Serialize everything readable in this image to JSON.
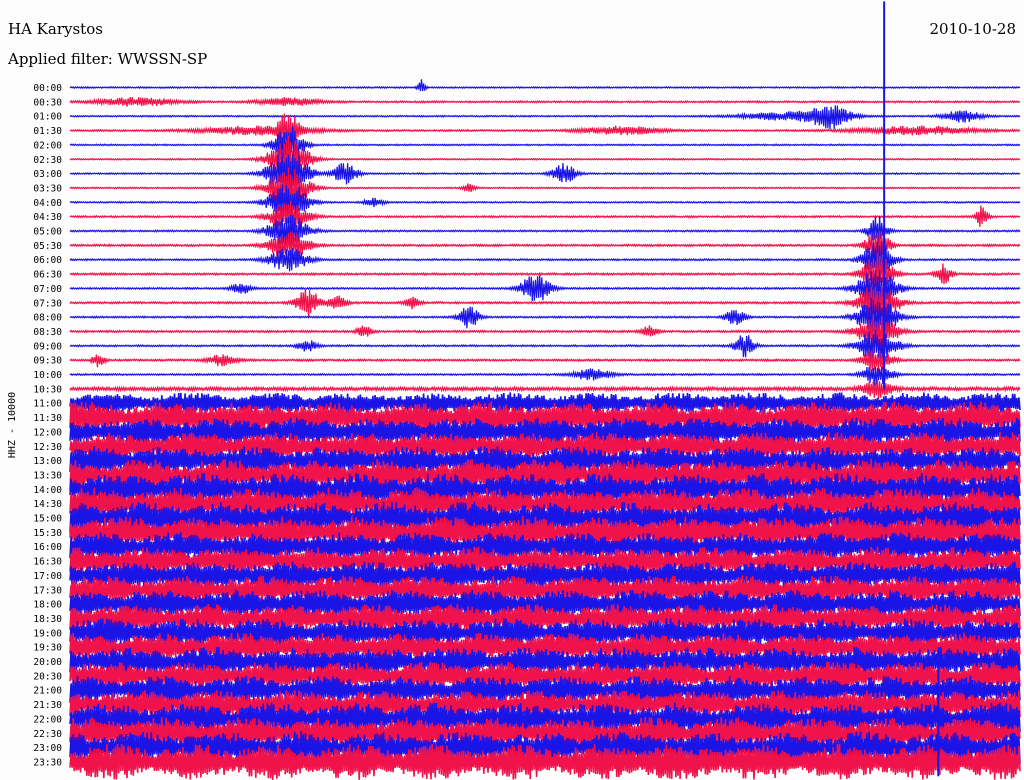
{
  "header": {
    "station": "HA Karystos",
    "date": "2010-10-28",
    "filter_label": "Applied filter: WWSSN-SP"
  },
  "colors": {
    "trace_a": "#1a14e6",
    "trace_b": "#f0124a",
    "background": "#fdfdfd",
    "text": "#000000"
  },
  "chart_data": {
    "type": "line",
    "title": "HA Karystos",
    "subtitle": "Applied filter: WWSSN-SP",
    "ylabel": "HHZ - 10000",
    "xlabel": "",
    "grid": false,
    "legend": "none",
    "row_labels": [
      "00:00",
      "00:30",
      "01:00",
      "01:30",
      "02:00",
      "02:30",
      "03:00",
      "03:30",
      "04:00",
      "04:30",
      "05:00",
      "05:30",
      "06:00",
      "06:30",
      "07:00",
      "07:30",
      "08:00",
      "08:30",
      "09:00",
      "09:30",
      "10:00",
      "10:30",
      "11:00",
      "11:30",
      "12:00",
      "12:30",
      "13:00",
      "13:30",
      "14:00",
      "14:30",
      "15:00",
      "15:30",
      "16:00",
      "16:30",
      "17:00",
      "17:30",
      "18:00",
      "18:30",
      "19:00",
      "19:30",
      "20:00",
      "20:30",
      "21:00",
      "21:30",
      "22:00",
      "22:30",
      "23:00",
      "23:30"
    ],
    "row_noise_amplitude": [
      0.5,
      0.6,
      0.5,
      0.6,
      0.5,
      0.5,
      0.5,
      0.5,
      0.5,
      0.6,
      0.6,
      0.7,
      0.6,
      0.7,
      0.6,
      0.7,
      0.6,
      0.7,
      0.6,
      0.7,
      0.6,
      1.2,
      6,
      9,
      8,
      8,
      8,
      9,
      9,
      9,
      9,
      9,
      8,
      8,
      8,
      8,
      8,
      8,
      8,
      8,
      8,
      8,
      8,
      8,
      9,
      9,
      9,
      10
    ],
    "events": [
      {
        "row": 0,
        "x": 0.37,
        "amp": 6,
        "width": 0.004
      },
      {
        "row": 1,
        "x": 0.07,
        "amp": 3,
        "width": 0.04
      },
      {
        "row": 1,
        "x": 0.23,
        "amp": 3,
        "width": 0.03
      },
      {
        "row": 2,
        "x": 0.8,
        "amp": 8,
        "width": 0.02
      },
      {
        "row": 2,
        "x": 0.76,
        "amp": 3,
        "width": 0.05
      },
      {
        "row": 2,
        "x": 0.94,
        "amp": 4,
        "width": 0.02
      },
      {
        "row": 3,
        "x": 0.2,
        "amp": 3,
        "width": 0.06
      },
      {
        "row": 3,
        "x": 0.58,
        "amp": 3,
        "width": 0.04
      },
      {
        "row": 3,
        "x": 0.89,
        "amp": 3,
        "width": 0.06
      },
      {
        "row": 3,
        "x": 0.23,
        "amp": 12,
        "width": 0.01
      },
      {
        "row": 4,
        "x": 0.23,
        "amp": 14,
        "width": 0.015
      },
      {
        "row": 5,
        "x": 0.23,
        "amp": 16,
        "width": 0.02
      },
      {
        "row": 6,
        "x": 0.23,
        "amp": 18,
        "width": 0.02
      },
      {
        "row": 6,
        "x": 0.29,
        "amp": 8,
        "width": 0.012
      },
      {
        "row": 6,
        "x": 0.52,
        "amp": 7,
        "width": 0.012
      },
      {
        "row": 7,
        "x": 0.23,
        "amp": 16,
        "width": 0.02
      },
      {
        "row": 7,
        "x": 0.42,
        "amp": 3,
        "width": 0.006
      },
      {
        "row": 8,
        "x": 0.23,
        "amp": 14,
        "width": 0.02
      },
      {
        "row": 8,
        "x": 0.32,
        "amp": 3,
        "width": 0.01
      },
      {
        "row": 9,
        "x": 0.23,
        "amp": 10,
        "width": 0.02
      },
      {
        "row": 9,
        "x": 0.96,
        "amp": 8,
        "width": 0.006
      },
      {
        "row": 10,
        "x": 0.23,
        "amp": 12,
        "width": 0.02
      },
      {
        "row": 10,
        "x": 0.85,
        "amp": 10,
        "width": 0.01
      },
      {
        "row": 11,
        "x": 0.23,
        "amp": 10,
        "width": 0.02
      },
      {
        "row": 11,
        "x": 0.85,
        "amp": 12,
        "width": 0.012
      },
      {
        "row": 12,
        "x": 0.23,
        "amp": 8,
        "width": 0.02
      },
      {
        "row": 12,
        "x": 0.85,
        "amp": 14,
        "width": 0.015
      },
      {
        "row": 13,
        "x": 0.85,
        "amp": 14,
        "width": 0.015
      },
      {
        "row": 13,
        "x": 0.92,
        "amp": 7,
        "width": 0.008
      },
      {
        "row": 14,
        "x": 0.18,
        "amp": 4,
        "width": 0.01
      },
      {
        "row": 14,
        "x": 0.49,
        "amp": 10,
        "width": 0.015
      },
      {
        "row": 14,
        "x": 0.85,
        "amp": 14,
        "width": 0.02
      },
      {
        "row": 15,
        "x": 0.25,
        "amp": 10,
        "width": 0.012
      },
      {
        "row": 15,
        "x": 0.28,
        "amp": 5,
        "width": 0.01
      },
      {
        "row": 15,
        "x": 0.36,
        "amp": 4,
        "width": 0.008
      },
      {
        "row": 15,
        "x": 0.85,
        "amp": 14,
        "width": 0.02
      },
      {
        "row": 16,
        "x": 0.42,
        "amp": 8,
        "width": 0.01
      },
      {
        "row": 16,
        "x": 0.7,
        "amp": 6,
        "width": 0.01
      },
      {
        "row": 16,
        "x": 0.85,
        "amp": 14,
        "width": 0.02
      },
      {
        "row": 17,
        "x": 0.31,
        "amp": 4,
        "width": 0.008
      },
      {
        "row": 17,
        "x": 0.61,
        "amp": 4,
        "width": 0.008
      },
      {
        "row": 17,
        "x": 0.85,
        "amp": 12,
        "width": 0.02
      },
      {
        "row": 18,
        "x": 0.25,
        "amp": 4,
        "width": 0.01
      },
      {
        "row": 18,
        "x": 0.71,
        "amp": 8,
        "width": 0.01
      },
      {
        "row": 18,
        "x": 0.85,
        "amp": 12,
        "width": 0.02
      },
      {
        "row": 19,
        "x": 0.03,
        "amp": 5,
        "width": 0.006
      },
      {
        "row": 19,
        "x": 0.16,
        "amp": 4,
        "width": 0.015
      },
      {
        "row": 19,
        "x": 0.85,
        "amp": 8,
        "width": 0.015
      },
      {
        "row": 20,
        "x": 0.55,
        "amp": 4,
        "width": 0.02
      },
      {
        "row": 20,
        "x": 0.85,
        "amp": 8,
        "width": 0.015
      },
      {
        "row": 21,
        "x": 0.85,
        "amp": 6,
        "width": 0.015
      }
    ],
    "vertical_spikes": [
      {
        "x": 0.857,
        "row_from": -6,
        "row_to": 21,
        "color": "trace_a"
      },
      {
        "x": 0.914,
        "row_from": 40,
        "row_to": 48,
        "color": "trace_a"
      }
    ]
  }
}
